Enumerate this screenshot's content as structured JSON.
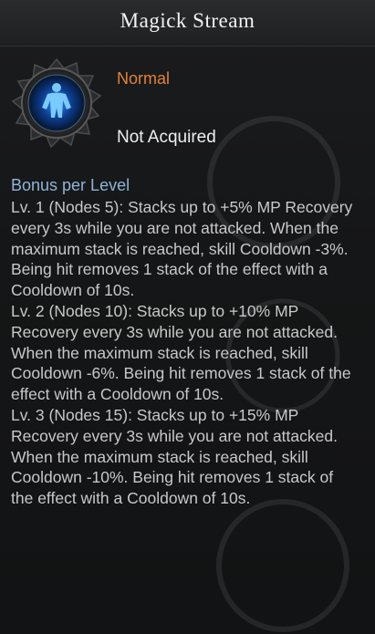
{
  "card": {
    "title": "Magick Stream",
    "rarity": "Normal",
    "status": "Not Acquired",
    "bonus_heading": "Bonus per Level",
    "levels": [
      "Lv. 1 (Nodes 5): Stacks up to +5% MP Recovery every 3s while you are not attacked. When the maximum stack is reached, skill Cooldown -3%. Being hit removes 1 stack of the effect with a Cooldown of 10s.",
      "Lv. 2 (Nodes 10): Stacks up to +10% MP Recovery every 3s while you are not attacked. When the maximum stack is reached, skill Cooldown -6%. Being hit removes 1 stack of the effect with a Cooldown of 10s.",
      "Lv. 3 (Nodes 15): Stacks up to +15% MP Recovery every 3s while you are not attacked. When the maximum stack is reached, skill Cooldown -10%. Being hit removes 1 stack of the effect with a Cooldown of 10s."
    ]
  },
  "icon": "magick-stream-rune-icon",
  "colors": {
    "rarity": "#e0823a",
    "heading": "#8fb4d8",
    "body": "#c8c8c8",
    "icon_glow": "#2f8cff"
  }
}
